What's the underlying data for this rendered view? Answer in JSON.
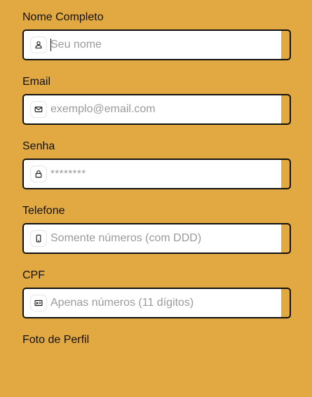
{
  "form": {
    "fields": [
      {
        "label": "Nome Completo",
        "placeholder": "Seu nome",
        "icon": "user-icon",
        "type": "text"
      },
      {
        "label": "Email",
        "placeholder": "exemplo@email.com",
        "icon": "envelope-icon",
        "type": "email"
      },
      {
        "label": "Senha",
        "placeholder": "********",
        "icon": "lock-icon",
        "type": "password"
      },
      {
        "label": "Telefone",
        "placeholder": "Somente números (com DDD)",
        "icon": "phone-icon",
        "type": "tel"
      },
      {
        "label": "CPF",
        "placeholder": "Apenas números (11 dígitos)",
        "icon": "id-card-icon",
        "type": "text"
      }
    ],
    "next_field_label": "Foto de Perfil"
  },
  "colors": {
    "background": "#e2a943",
    "input_background": "#ffffff",
    "border": "#111111",
    "placeholder": "#9a9a9a",
    "label": "#111111"
  }
}
